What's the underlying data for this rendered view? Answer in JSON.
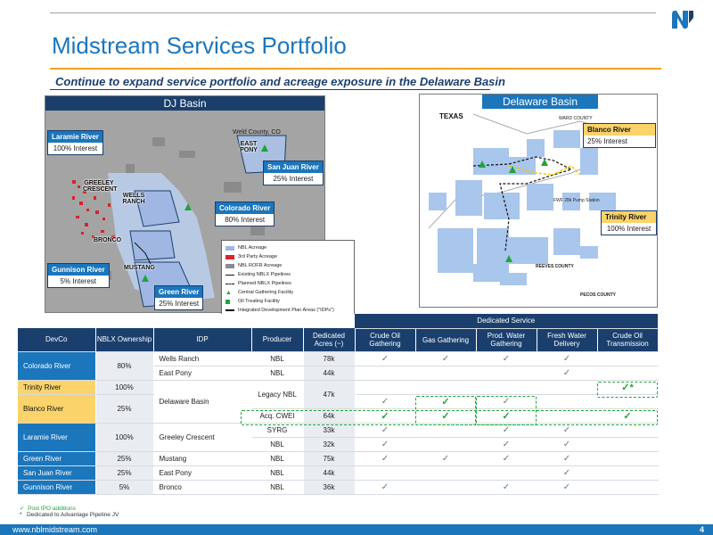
{
  "header": {
    "title": "Midstream Services Portfolio",
    "subtitle": "Continue to expand service portfolio and acreage exposure in the Delaware Basin"
  },
  "dj_map": {
    "title": "DJ Basin",
    "county_label": "Weld County, CO",
    "areas": [
      "GREELEY CRESCENT",
      "WELLS RANCH",
      "EAST PONY",
      "BRONCO",
      "MUSTANG"
    ],
    "callouts": [
      {
        "name": "Laramie River",
        "interest": "100% Interest"
      },
      {
        "name": "San Juan River",
        "interest": "25% Interest"
      },
      {
        "name": "Colorado River",
        "interest": "80% Interest"
      },
      {
        "name": "Gunnison River",
        "interest": "5% Interest"
      },
      {
        "name": "Green River",
        "interest": "25% Interest"
      }
    ],
    "legend": [
      "NBL Acreage",
      "3rd Party Acreage",
      "NBL ROFR Acreage",
      "Existing NBLX Pipelines",
      "Planned NBLX Pipelines",
      "Central Gathering Facility",
      "Oil Treating Facility",
      "Integrated Development Plan Areas (\"IDPs\")"
    ]
  },
  "de_map": {
    "title": "Delaware Basin",
    "state_label": "TEXAS",
    "labels": [
      "WARD COUNTY",
      "REEVES COUNTY",
      "PECOS COUNTY",
      "FWF 28k Pump Station"
    ],
    "callouts": [
      {
        "name": "Blanco River",
        "interest": "25% Interest"
      },
      {
        "name": "Trinity River",
        "interest": "100% Interest"
      }
    ]
  },
  "table": {
    "dedicated_header": "Dedicated Service",
    "columns": [
      "DevCo",
      "NBLX Ownership",
      "IDP",
      "Producer",
      "Dedicated Acres (~)",
      "Crude Oil Gathering",
      "Gas Gathering",
      "Prod. Water Gathering",
      "Fresh Water Delivery",
      "Crude Oil Transmission"
    ],
    "check": "✓",
    "check_star": "✓*",
    "rows": [
      {
        "devco": "Colorado River",
        "own": "80%",
        "idp": "Wells Ranch",
        "producer": "NBL",
        "acres": "78k"
      },
      {
        "devco": "",
        "own": "",
        "idp": "East Pony",
        "producer": "NBL",
        "acres": "44k"
      },
      {
        "devco": "Trinity River",
        "own": "100%",
        "idp": "Delaware Basin",
        "producer": "Legacy NBL",
        "acres": "47k"
      },
      {
        "devco": "Blanco River",
        "own": "25%",
        "idp": "",
        "producer": "Acq. CWEI",
        "acres": "64k"
      },
      {
        "devco": "Laramie River",
        "own": "100%",
        "idp": "Greeley Crescent",
        "producer": "SYRG",
        "acres": "33k"
      },
      {
        "devco": "",
        "own": "",
        "idp": "",
        "producer": "NBL",
        "acres": "32k"
      },
      {
        "devco": "Green River",
        "own": "25%",
        "idp": "Mustang",
        "producer": "NBL",
        "acres": "75k"
      },
      {
        "devco": "San Juan River",
        "own": "25%",
        "idp": "East Pony",
        "producer": "NBL",
        "acres": "44k"
      },
      {
        "devco": "Gunnison River",
        "own": "5%",
        "idp": "Bronco",
        "producer": "NBL",
        "acres": "36k"
      }
    ]
  },
  "footnotes": {
    "green": "Post IPO additions",
    "star": "Dedicated to Advantage Pipeline JV"
  },
  "footer": {
    "url": "www.nblmidstream.com",
    "page": "4"
  }
}
